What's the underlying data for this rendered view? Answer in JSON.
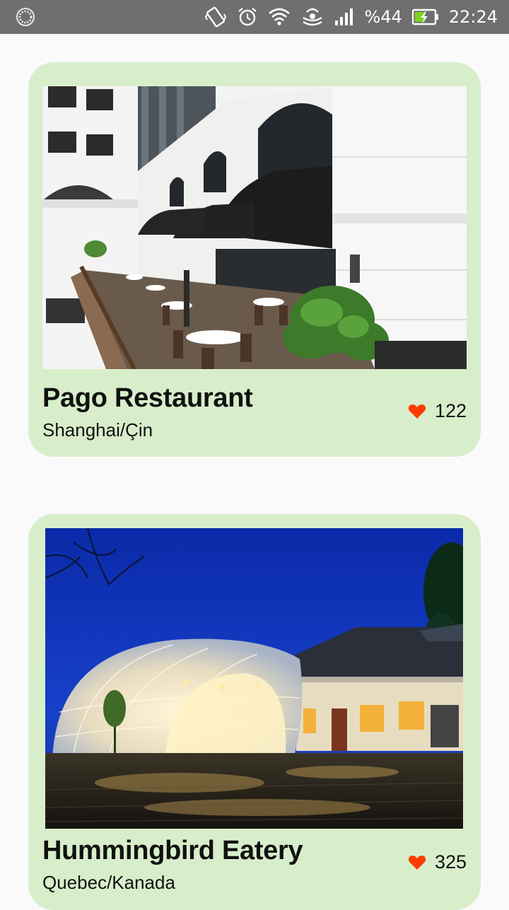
{
  "status_bar": {
    "battery": "%44",
    "time": "22:24",
    "icons": [
      "circle-loader-icon",
      "vibrate-icon",
      "alarm-icon",
      "wifi-icon",
      "hotspot-icon",
      "signal-icon",
      "battery-charging-icon"
    ],
    "battery_color": "#7ed321"
  },
  "cards": [
    {
      "title": "Pago Restaurant",
      "location": "Shanghai/Çin",
      "likes": "122",
      "image": "restaurant-terrace-photo"
    },
    {
      "title": "Hummingbird Eatery",
      "location": "Quebec/Kanada",
      "likes": "325",
      "image": "night-dome-restaurant-photo"
    }
  ],
  "colors": {
    "card_bg": "#d8eecb",
    "heart": "#ff3d00",
    "status_bar": "#6f6f6f"
  }
}
